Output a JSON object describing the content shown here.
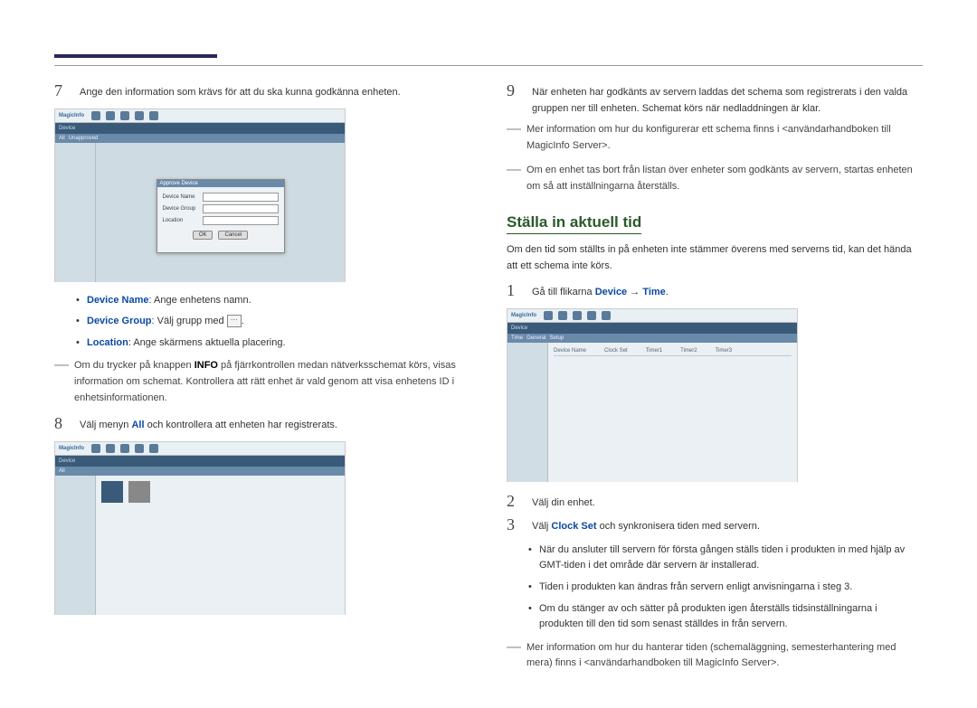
{
  "left": {
    "step7": {
      "num": "7",
      "text": "Ange den information som krävs för att du ska kunna godkänna enheten."
    },
    "screenshot1": {
      "logo": "MagicInfo",
      "dialog_title": "Approve Device",
      "dlg_row1_label": "Device Name",
      "dlg_row2_label": "Device Group",
      "dlg_row3_label": "Location",
      "btn_ok": "OK",
      "btn_cancel": "Cancel"
    },
    "bullets": [
      {
        "kw": "Device Name",
        "rest": ": Ange enhetens namn."
      },
      {
        "kw": "Device Group",
        "rest": ": Välj grupp med "
      },
      {
        "kw": "Location",
        "rest": ": Ange skärmens aktuella placering."
      }
    ],
    "dots_suffix": ".",
    "note1_prefix": "Om du trycker på knappen ",
    "note1_kw": "INFO",
    "note1_rest": " på fjärrkontrollen medan nätverksschemat körs, visas information om schemat. Kontrollera att rätt enhet är vald genom att visa enhetens ID i enhetsinformationen.",
    "step8": {
      "num": "8",
      "text_pre": "Välj menyn ",
      "kw": "All",
      "text_post": " och kontrollera att enheten har registrerats."
    },
    "screenshot2": {
      "logo": "MagicInfo"
    }
  },
  "right": {
    "step9": {
      "num": "9",
      "text": "När enheten har godkänts av servern laddas det schema som registrerats i den valda gruppen ner till enheten. Schemat körs när nedladdningen är klar."
    },
    "note1": "Mer information om hur du konfigurerar ett schema finns i <användarhandboken till MagicInfo Server>.",
    "note2": "Om en enhet tas bort från listan över enheter som godkänts av servern, startas enheten om så att inställningarna återställs.",
    "heading": "Ställa in aktuell tid",
    "intro": "Om den tid som ställts in på enheten inte stämmer överens med serverns tid, kan det hända att ett schema inte körs.",
    "step1": {
      "num": "1",
      "text_pre": "Gå till flikarna ",
      "kw1": "Device",
      "arrow": " → ",
      "kw2": "Time",
      "text_post": "."
    },
    "screenshot3": {
      "logo": "MagicInfo"
    },
    "step2": {
      "num": "2",
      "text": "Välj din enhet."
    },
    "step3": {
      "num": "3",
      "text_pre": "Välj ",
      "kw": "Clock Set",
      "text_post": " och synkronisera tiden med servern."
    },
    "bullets": [
      "När du ansluter till servern för första gången ställs tiden i produkten in med hjälp av GMT-tiden i det område där servern är installerad.",
      "Tiden i produkten kan ändras från servern enligt anvisningarna i steg 3.",
      "Om du stänger av och sätter på produkten igen återställs tidsinställningarna i produkten till den tid som senast ställdes in från servern."
    ],
    "note3": "Mer information om hur du hanterar tiden (schemaläggning, semesterhantering med mera) finns i <användarhandboken till MagicInfo Server>."
  }
}
